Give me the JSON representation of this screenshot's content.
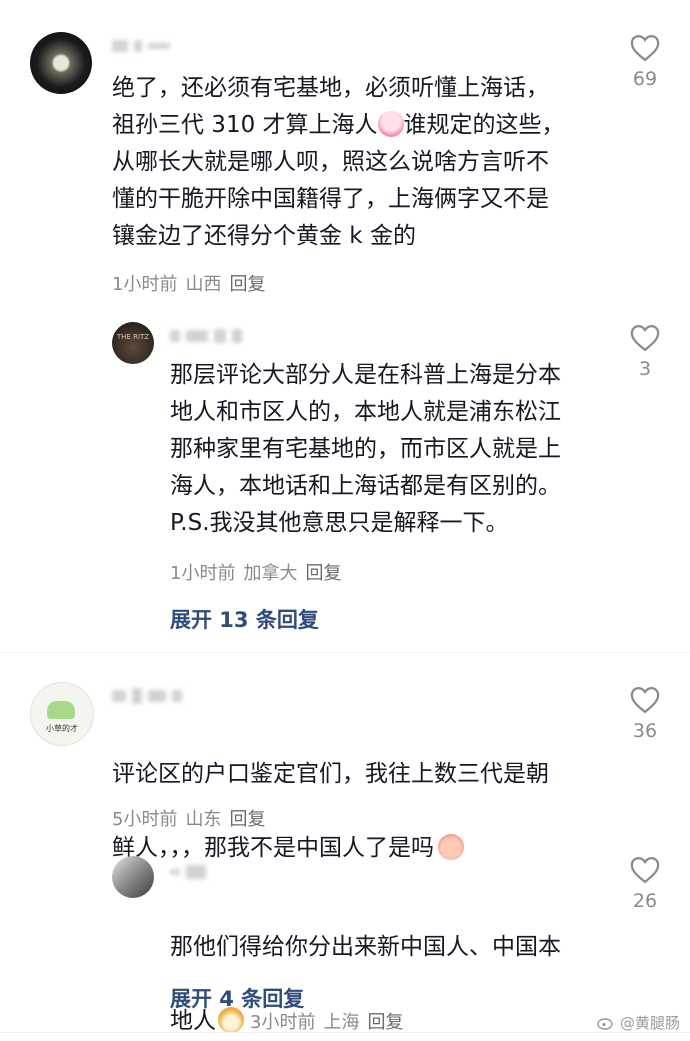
{
  "comments": [
    {
      "text": "绝了，还必须有宅基地，必须听懂上海话，\n祖孙三代 310 才算上海人",
      "text_after_emoji": "谁规定的这些，\n从哪长大就是哪人呗，照这么说啥方言听不\n懂的干脆开除中国籍得了，上海俩字又不是\n镶金边了还得分个黄金 k 金的",
      "time": "1小时前",
      "location": "山西",
      "reply": "回复",
      "likes": "69"
    },
    {
      "avatar_text": "THE RITZ",
      "text": "那层评论大部分人是在科普上海是分本\n地人和市区人的，本地人就是浦东松江\n那种家里有宅基地的，而市区人就是上\n海人，本地话和上海话都是有区别的。\nP.S.我没其他意思只是解释一下。",
      "time": "1小时前",
      "location": "加拿大",
      "reply": "回复",
      "likes": "3",
      "expand": "展开 13 条回复"
    },
    {
      "avatar_text": "小草的才",
      "text_line1": "评论区的户口鉴定官们，我往上数三代是朝",
      "text_line2": "鲜人，，，那我不是中国人了是吗",
      "time": "5小时前",
      "location": "山东",
      "reply": "回复",
      "likes": "36"
    },
    {
      "text_line1": "那他们得给你分出来新中国人、中国本",
      "text_line2": "地人",
      "time": "3小时前",
      "location": "上海",
      "reply": "回复",
      "likes": "26",
      "expand": "展开 4 条回复"
    }
  ],
  "watermark": "@黄腿肠",
  "colors": {
    "link": "#2f4c7a",
    "meta": "#8a8a8a",
    "text": "#161823"
  },
  "icons": [
    "heart-outline-icon",
    "emoji-crying-icon",
    "emoji-peach-icon",
    "emoji-fox-icon",
    "weibo-logo-icon"
  ]
}
